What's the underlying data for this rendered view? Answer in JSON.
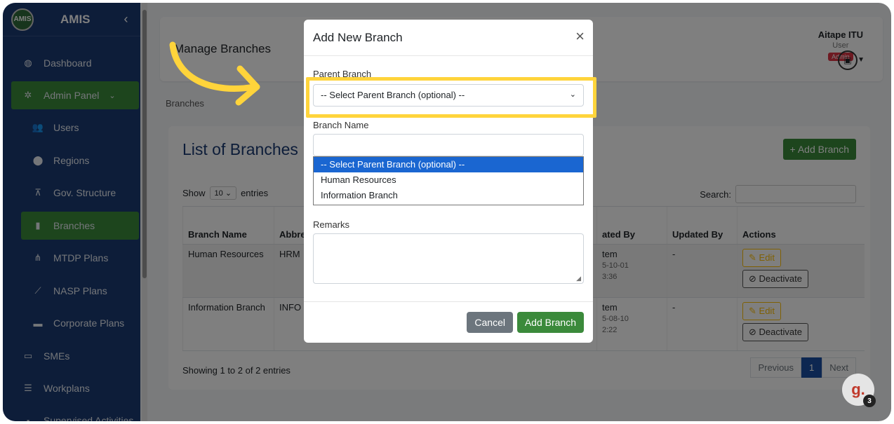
{
  "sidebar": {
    "logo_text": "AMIS",
    "brand": "AMIS",
    "collapse_glyph": "‹",
    "items": [
      {
        "label": "Dashboard",
        "icon": "◍"
      },
      {
        "label": "Admin Panel",
        "icon": "✲",
        "chevron": "⌄"
      },
      {
        "label": "Users",
        "icon": "👥"
      },
      {
        "label": "Regions",
        "icon": "⬤"
      },
      {
        "label": "Gov. Structure",
        "icon": "⊼"
      },
      {
        "label": "Branches",
        "icon": "▮"
      },
      {
        "label": "MTDP Plans",
        "icon": "⋔"
      },
      {
        "label": "NASP Plans",
        "icon": "⟋"
      },
      {
        "label": "Corporate Plans",
        "icon": "▬"
      },
      {
        "label": "SMEs",
        "icon": "▭"
      },
      {
        "label": "Workplans",
        "icon": "☰"
      },
      {
        "label": "Supervised Activities",
        "icon": "▪"
      }
    ]
  },
  "header": {
    "title": "Manage Branches",
    "user_name": "Aitape ITU",
    "user_role": "User",
    "user_badge": "Admin"
  },
  "breadcrumb": "Branches",
  "list": {
    "heading": "List of Branches",
    "add_button": "+ Add Branch",
    "show_label": "Show",
    "show_value": "10",
    "entries_label": "entries",
    "search_label": "Search:",
    "columns": [
      "Branch Name",
      "Abbre",
      "ated By",
      "Updated By",
      "Actions"
    ],
    "rows": [
      {
        "name": "Human Resources",
        "abbr": "HRM",
        "created": [
          "tem",
          "5-10-01",
          "3:36"
        ],
        "updated": "-"
      },
      {
        "name": "Information Branch",
        "abbr": "INFO",
        "created": [
          "tem",
          "5-08-10",
          "2:22"
        ],
        "updated": "-"
      }
    ],
    "edit_label": "Edit",
    "deactivate_label": "Deactivate",
    "showing": "Showing 1 to 2 of 2 entries",
    "pager": {
      "prev": "Previous",
      "page": "1",
      "next": "Next"
    }
  },
  "modal": {
    "title": "Add New Branch",
    "close_glyph": "×",
    "parent_label": "Parent Branch",
    "parent_selected": "-- Select Parent Branch (optional) --",
    "name_label": "Branch Name",
    "options": [
      "-- Select Parent Branch (optional) --",
      "Human Resources",
      "Information Branch"
    ],
    "remarks_label": "Remarks",
    "cancel": "Cancel",
    "submit": "Add Branch"
  },
  "help": {
    "glyph": "g.",
    "count": "3"
  },
  "colors": {
    "sidebar": "#1a3a73",
    "accent": "#3b8a3b",
    "highlight": "#ffd43b",
    "danger": "#dc3545"
  }
}
